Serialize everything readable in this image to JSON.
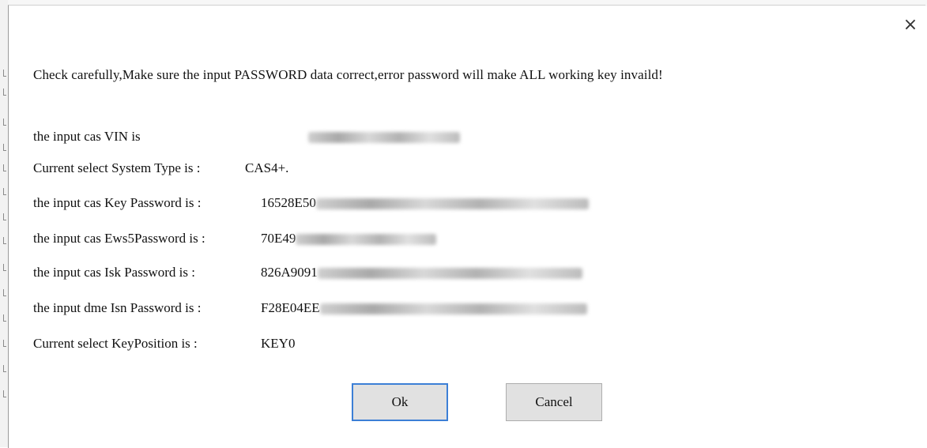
{
  "dialog": {
    "close_glyph": "×",
    "message": "Check carefully,Make sure the input PASSWORD data correct,error password will make ALL working key invaild!",
    "rows": [
      {
        "label": "the input cas VIN is",
        "value": "",
        "blurred": true
      },
      {
        "label": "Current select System Type is :",
        "value": "CAS4+.",
        "blurred": false
      },
      {
        "label": "the input cas Key Password is :",
        "value": "16528E50",
        "blurred": true
      },
      {
        "label": "the input cas Ews5Password is :",
        "value": "70E49",
        "blurred": true
      },
      {
        "label": "the input cas Isk Password is :",
        "value": "826A9091",
        "blurred": true
      },
      {
        "label": "the input dme Isn Password is :",
        "value": "F28E04EE",
        "blurred": true
      },
      {
        "label": "Current select KeyPosition is :",
        "value": "KEY0",
        "blurred": false
      }
    ],
    "ok_label": "Ok",
    "cancel_label": "Cancel"
  },
  "colors": {
    "default_button_border": "#3c7fd6",
    "button_bg": "#e1e1e1"
  }
}
